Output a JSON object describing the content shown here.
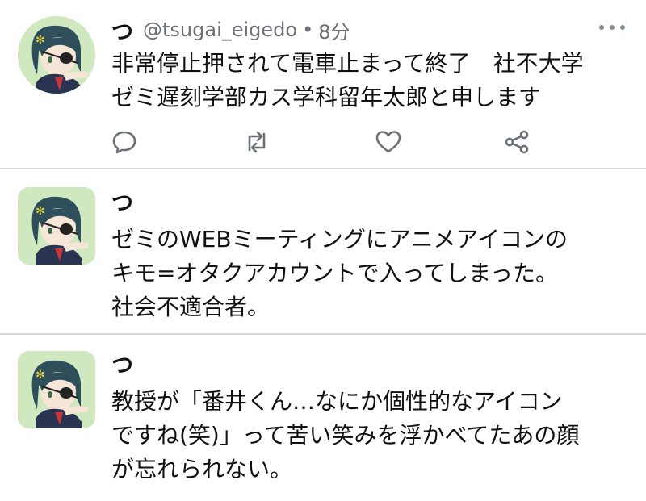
{
  "tweets": [
    {
      "display_name": "つ",
      "handle": "@tsugai_eigedo",
      "separator": "•",
      "time": "8分",
      "text": "非常停止押されて電車止まって終了　社不大学\nゼミ遅刻学部カス学科留年太郎と申します",
      "actions": [
        "reply-icon",
        "retweet-icon",
        "like-icon",
        "share-icon"
      ]
    },
    {
      "display_name": "つ",
      "text": "ゼミのWEBミーティングにアニメアイコンの\nキモ=オタクアカウントで入ってしまった。\n社会不適合者。"
    },
    {
      "display_name": "つ",
      "text": "教授が「番井くん…なにか個性的なアイコン\nですね(笑)」って苦い笑みを浮かべてたあの顔\nが忘れられない。"
    }
  ],
  "colors": {
    "avatar_bg": "#cfe8bf",
    "divider": "#d6d6d6",
    "muted_text": "#6b7076",
    "icon": "#6b7076"
  }
}
